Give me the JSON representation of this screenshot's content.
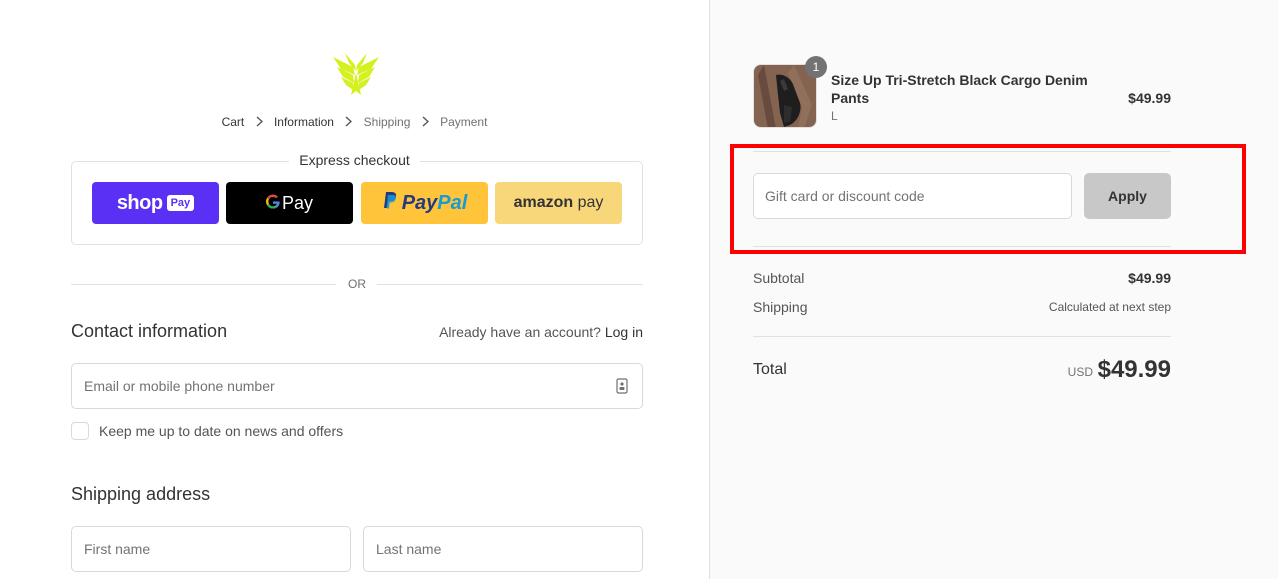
{
  "brand": {
    "logo_color": "#d4f01f"
  },
  "breadcrumb": [
    {
      "label": "Cart"
    },
    {
      "label": "Information"
    },
    {
      "label": "Shipping"
    },
    {
      "label": "Payment"
    }
  ],
  "express": {
    "title": "Express checkout",
    "shop_pay": {
      "text": "shop",
      "badge": "Pay",
      "color": "#5a31f4"
    },
    "google_pay": {
      "g": "G",
      "text": "Pay"
    },
    "paypal": {
      "pay": "Pay",
      "pal": "Pal"
    },
    "amazon_pay": {
      "bold": "amazon",
      "text": " pay"
    }
  },
  "or_label": "OR",
  "contact": {
    "title": "Contact information",
    "account_prompt": "Already have an account?",
    "login_label": "Log in",
    "email_placeholder": "Email or mobile phone number",
    "newsletter_label": "Keep me up to date on news and offers"
  },
  "shipping": {
    "title": "Shipping address",
    "first_name_placeholder": "First name",
    "last_name_placeholder": "Last name"
  },
  "order": {
    "product": {
      "name": "Size Up Tri-Stretch Black Cargo Denim Pants",
      "variant": "L",
      "price": "$49.99",
      "quantity": "1"
    },
    "discount_placeholder": "Gift card or discount code",
    "apply_label": "Apply",
    "subtotal_label": "Subtotal",
    "subtotal_value": "$49.99",
    "shipping_label": "Shipping",
    "shipping_value": "Calculated at next step",
    "total_label": "Total",
    "total_currency": "USD",
    "total_value": "$49.99"
  },
  "colors": {
    "highlight": "#ff0000",
    "apply_bg": "#c8c8c8"
  }
}
